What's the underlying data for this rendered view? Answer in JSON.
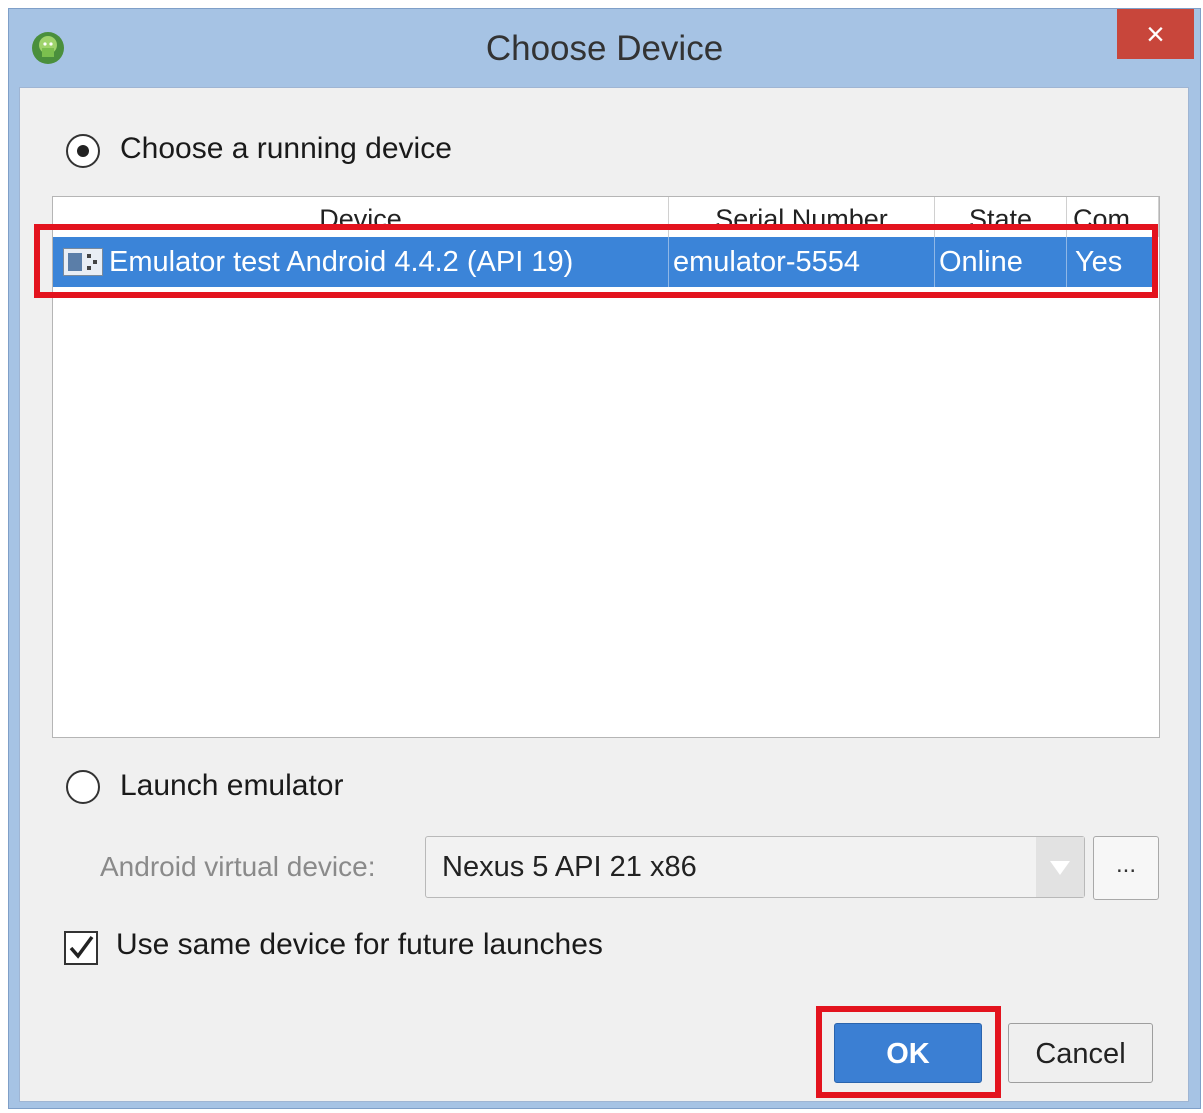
{
  "window": {
    "title": "Choose Device",
    "close_glyph": "×",
    "icon": "android-icon"
  },
  "running": {
    "label": "Choose a running device",
    "selected": true
  },
  "device_table": {
    "columns": [
      "Device",
      "Serial Number",
      "State",
      "Com"
    ],
    "rows": [
      {
        "device": "Emulator test Android 4.4.2 (API 19)",
        "serial": "emulator-5554",
        "state": "Online",
        "compatible": "Yes",
        "icon": "emulator-device-icon",
        "selected": true
      }
    ]
  },
  "emulator": {
    "label": "Launch emulator",
    "selected": false,
    "avd_label": "Android virtual device:",
    "avd_value": "Nexus 5 API 21 x86",
    "browse_label": "..."
  },
  "future": {
    "label": "Use same device for future launches",
    "checked": true
  },
  "buttons": {
    "ok": "OK",
    "cancel": "Cancel"
  },
  "colors": {
    "selection": "#3b84d8",
    "highlight": "#e3131e",
    "ok_button": "#3b7fd3",
    "close_button": "#c8463b"
  }
}
